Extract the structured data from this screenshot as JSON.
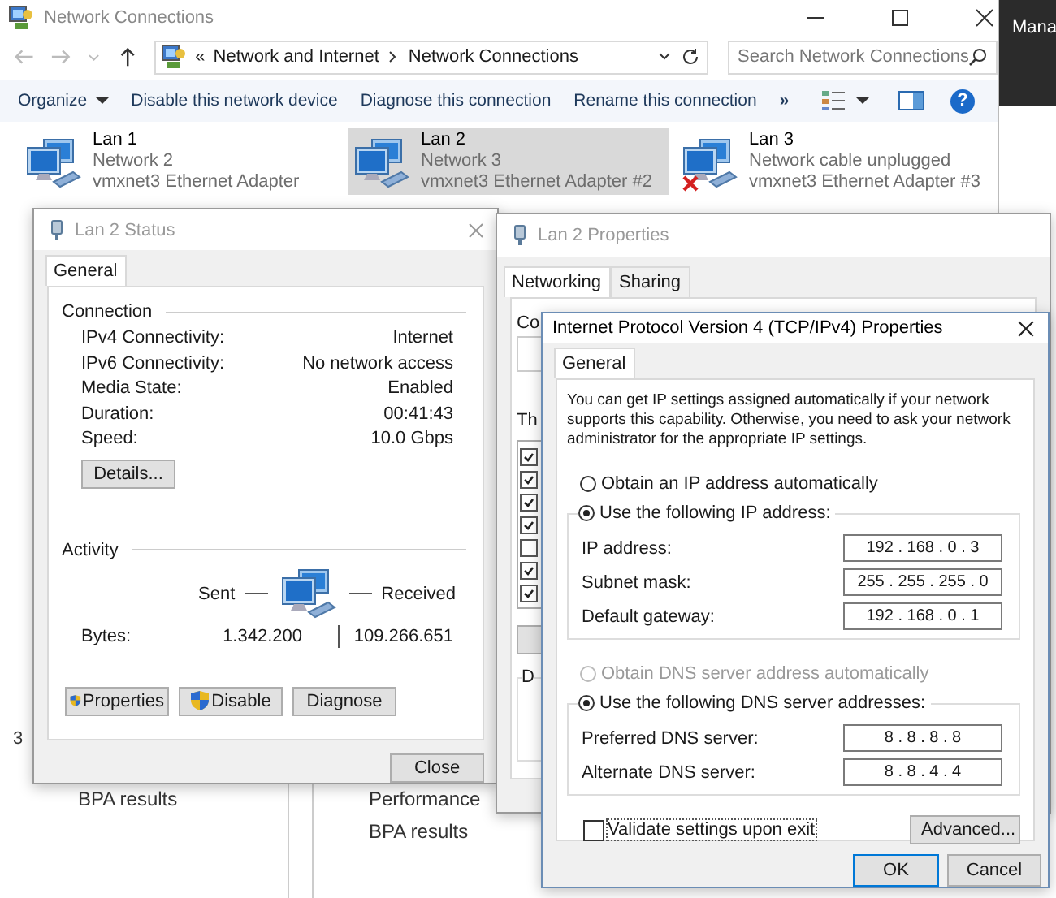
{
  "explorer": {
    "title": "Network Connections",
    "breadcrumb_prefix": "«",
    "breadcrumb": [
      "Network and Internet",
      "Network Connections"
    ],
    "search_placeholder": "Search Network Connections",
    "toolbar": [
      {
        "label": "Organize",
        "dropdown": true
      },
      {
        "label": "Disable this network device",
        "dropdown": false
      },
      {
        "label": "Diagnose this connection",
        "dropdown": false
      },
      {
        "label": "Rename this connection",
        "dropdown": false
      }
    ],
    "more": "»",
    "help": "?",
    "connections": [
      {
        "name": "Lan 1",
        "network": "Network 2",
        "adapter": "vmxnet3 Ethernet Adapter",
        "selected": false,
        "unplugged": false
      },
      {
        "name": "Lan 2",
        "network": "Network 3",
        "adapter": "vmxnet3 Ethernet Adapter #2",
        "selected": true,
        "unplugged": false
      },
      {
        "name": "Lan 3",
        "network": "Network cable unplugged",
        "adapter": "vmxnet3 Ethernet Adapter #3",
        "selected": false,
        "unplugged": true
      }
    ],
    "status_bar": "3"
  },
  "side_panel": {
    "text": "Mana"
  },
  "server_manager": {
    "columns": [
      [
        "BPA results"
      ],
      [
        "Performance",
        "BPA results"
      ]
    ]
  },
  "status_dialog": {
    "title": "Lan 2 Status",
    "tabs": [
      {
        "label": "General",
        "selected": true
      }
    ],
    "connection_heading": "Connection",
    "rows": [
      {
        "label": "IPv4 Connectivity:",
        "value": "Internet"
      },
      {
        "label": "IPv6 Connectivity:",
        "value": "No network access"
      },
      {
        "label": "Media State:",
        "value": "Enabled"
      },
      {
        "label": "Duration:",
        "value": "00:41:43"
      },
      {
        "label": "Speed:",
        "value": "10.0 Gbps"
      }
    ],
    "details_button": "Details...",
    "activity_heading": "Activity",
    "sent": "Sent",
    "received": "Received",
    "bytes_label": "Bytes:",
    "sent_bytes": "1.342.200",
    "received_bytes": "109.266.651",
    "buttons": [
      {
        "label": "Properties",
        "shield": true
      },
      {
        "label": "Disable",
        "shield": true
      },
      {
        "label": "Diagnose",
        "shield": false
      }
    ],
    "close": "Close"
  },
  "properties_dialog": {
    "title": "Lan 2 Properties",
    "tabs": [
      {
        "label": "Networking",
        "selected": true
      },
      {
        "label": "Sharing",
        "selected": false
      }
    ],
    "label_fragments": [
      "Co",
      "Th",
      "D"
    ],
    "items": [
      {
        "checked": true
      },
      {
        "checked": true
      },
      {
        "checked": true
      },
      {
        "checked": true
      },
      {
        "checked": false
      },
      {
        "checked": true
      },
      {
        "checked": true
      }
    ]
  },
  "tcp_dialog": {
    "title": "Internet Protocol Version 4 (TCP/IPv4) Properties",
    "tabs": [
      {
        "label": "General",
        "selected": true
      }
    ],
    "description": "You can get IP settings assigned automatically if your network supports this capability. Otherwise, you need to ask your network administrator for the appropriate IP settings.",
    "ip_options": [
      {
        "label": "Obtain an IP address automatically",
        "selected": false,
        "disabled": false
      },
      {
        "label": "Use the following IP address:",
        "selected": true,
        "disabled": false
      }
    ],
    "ip_fields": [
      {
        "label": "IP address:",
        "value": "192 . 168 . 0 . 3"
      },
      {
        "label": "Subnet mask:",
        "value": "255 . 255 . 255 . 0"
      },
      {
        "label": "Default gateway:",
        "value": "192 . 168 . 0 . 1"
      }
    ],
    "dns_options": [
      {
        "label": "Obtain DNS server address automatically",
        "selected": false,
        "disabled": true
      },
      {
        "label": "Use the following DNS server addresses:",
        "selected": true,
        "disabled": false
      }
    ],
    "dns_fields": [
      {
        "label": "Preferred DNS server:",
        "value": "8 . 8 . 8 . 8"
      },
      {
        "label": "Alternate DNS server:",
        "value": "8 . 8 . 4 . 4"
      }
    ],
    "validate": {
      "label": "Validate settings upon exit",
      "checked": false
    },
    "advanced": "Advanced...",
    "buttons": [
      {
        "label": "OK",
        "default": true
      },
      {
        "label": "Cancel",
        "default": false
      }
    ]
  }
}
